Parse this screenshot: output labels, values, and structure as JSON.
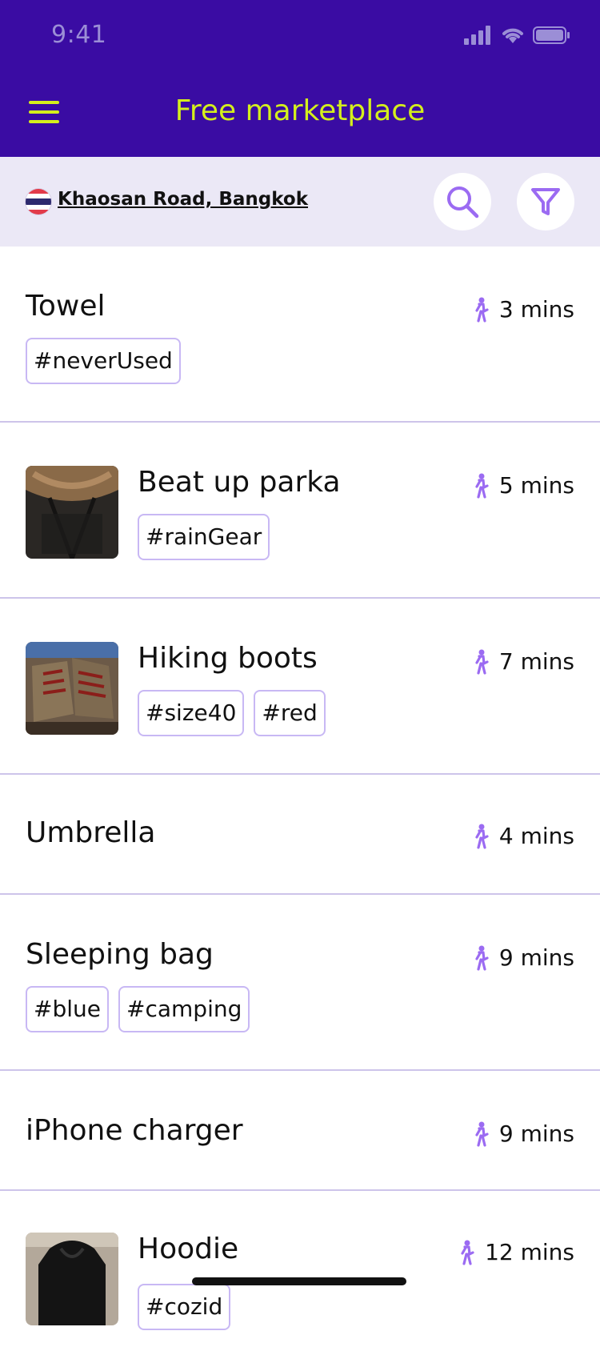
{
  "status_bar": {
    "time": "9:41"
  },
  "header": {
    "title": "Free marketplace"
  },
  "location": {
    "name": "Khaosan Road, Bangkok"
  },
  "icons": {
    "menu": "hamburger-menu-icon",
    "search": "search-icon",
    "filter": "filter-icon",
    "distance": "walking-person-icon",
    "flag": "thailand-flag-icon"
  },
  "colors": {
    "header_bg": "#3a0ca3",
    "title_text": "#d4ef1c",
    "accent": "#9b6bf2",
    "location_bar_bg": "#ebe8f6",
    "divider": "#cdc4ea"
  },
  "items": [
    {
      "title": "Towel",
      "tags": [
        "#neverUsed"
      ],
      "distance": "3 mins"
    },
    {
      "title": "Beat up parka",
      "tags": [
        "#rainGear"
      ],
      "distance": "5 mins"
    },
    {
      "title": "Hiking boots",
      "tags": [
        "#size40",
        "#red"
      ],
      "distance": "7 mins"
    },
    {
      "title": "Umbrella",
      "tags": [],
      "distance": "4 mins"
    },
    {
      "title": "Sleeping bag",
      "tags": [
        "#blue",
        "#camping"
      ],
      "distance": "9 mins"
    },
    {
      "title": "iPhone charger",
      "tags": [],
      "distance": "9 mins"
    },
    {
      "title": "Hoodie",
      "tags": [
        "#cozid"
      ],
      "distance": "12 mins"
    }
  ]
}
